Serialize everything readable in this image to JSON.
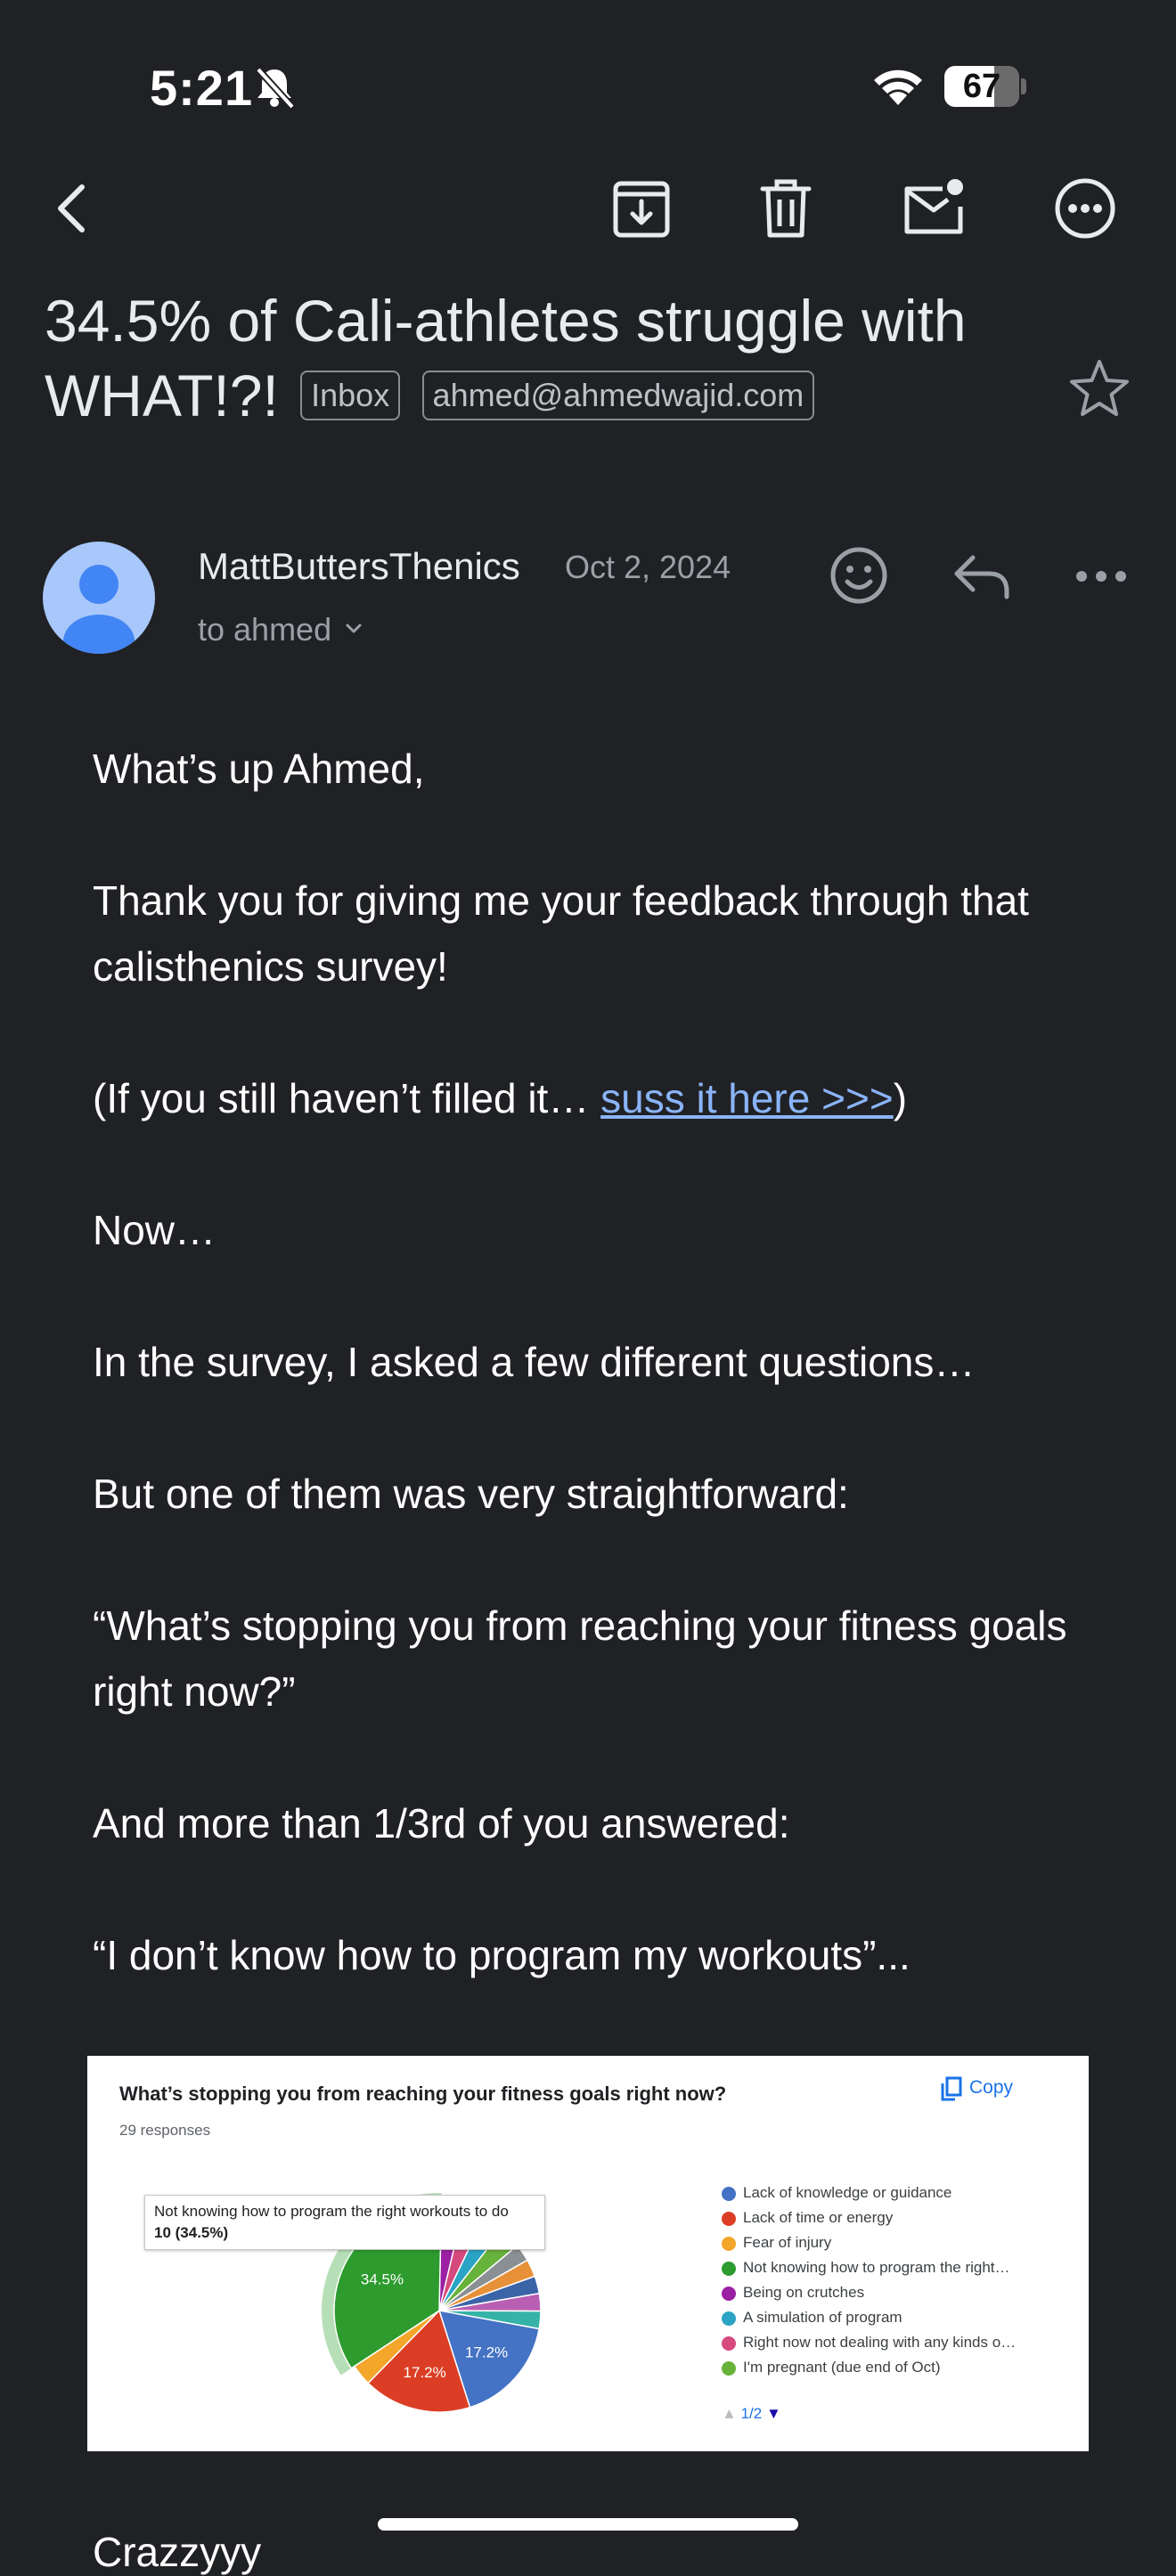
{
  "status_bar": {
    "time": "5:21",
    "battery": "67",
    "battery_level": 0.67
  },
  "toolbar": {
    "icons": [
      "back-arrow-icon",
      "archive-icon",
      "delete-icon",
      "mark-unread-icon",
      "more-options-icon"
    ]
  },
  "subject": {
    "text": "34.5% of Cali-athletes struggle with WHAT!?!",
    "labels": [
      "Inbox",
      "ahmed@ahmedwajid.com"
    ]
  },
  "message": {
    "sender": "MattButtersThenics",
    "date": "Oct 2, 2024",
    "recipient": "to ahmed",
    "body": {
      "greeting": "What’s up Ahmed,",
      "p1": "Thank you for giving me your feedback through that calisthenics survey!",
      "p2_before": "(If you still haven’t filled it… ",
      "p2_link": "suss it here >>>",
      "p2_after": ")",
      "p3": "Now…",
      "p4": "In the survey, I asked a few different questions…",
      "p5": "But one of them was very straightforward:",
      "p6": "“What’s stopping you from reaching your fitness goals right now?”",
      "p7": "And more than 1/3rd of you answered:",
      "p8": "“I don’t know how to program my workouts”...",
      "p9": "Crazzyyy"
    }
  },
  "chart_card": {
    "title": "What’s stopping you from reaching your fitness goals right now?",
    "responses": "29 responses",
    "copy_label": "Copy",
    "tooltip_line1": "Not knowing how to program the right workouts to do",
    "tooltip_line2": "10 (34.5%)",
    "pager": "1/2"
  },
  "chart_data": {
    "type": "pie",
    "title": "What’s stopping you from reaching your fitness goals right now?",
    "categories": [
      "Lack of knowledge or guidance",
      "Lack of time or energy",
      "Fear of injury",
      "Not knowing how to program the right…",
      "Being on crutches",
      "A simulation of program",
      "Right now not dealing with any kinds o…",
      "I'm pregnant (due end of Oct)"
    ],
    "values": [
      17.2,
      17.2,
      3.4,
      34.5,
      3.4,
      3.4,
      3.4,
      3.4
    ],
    "other_value": 13.9,
    "colors": [
      "#4472c4",
      "#db3e24",
      "#f4a62a",
      "#2d9b2e",
      "#9a1fa3",
      "#2aa3c4",
      "#d6497c",
      "#67b23a"
    ],
    "other_colors": [
      "#8a8f94",
      "#e69138",
      "#3b63a8",
      "#b85fb3",
      "#35b3a8"
    ],
    "data_labels": [
      "34.5%",
      "17.2%",
      "17.2%"
    ],
    "legend_position": "right"
  }
}
